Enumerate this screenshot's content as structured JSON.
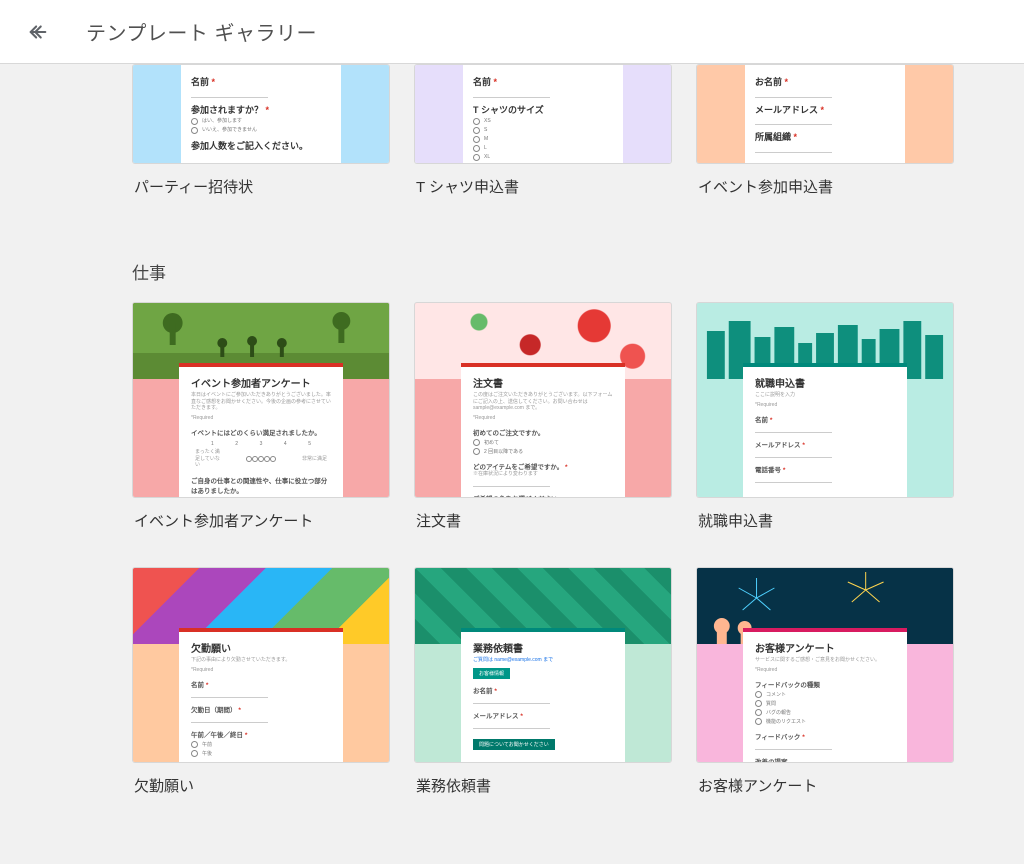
{
  "header": {
    "title": "テンプレート ギャラリー",
    "back_icon": "arrow-left"
  },
  "sections": [
    {
      "title": "",
      "cards": [
        {
          "id": "party-invite",
          "title": "パーティー招待状",
          "sideColor": "#b2e2fb",
          "fields": [
            {
              "type": "label",
              "text": "名前",
              "req": true
            },
            {
              "type": "answer"
            },
            {
              "type": "label",
              "text": "参加されますか？",
              "req": true
            },
            {
              "type": "radio",
              "text": "はい、参加します"
            },
            {
              "type": "radio",
              "text": "いいえ、参加できません"
            },
            {
              "type": "label",
              "text": "参加人数をご記入ください。"
            }
          ]
        },
        {
          "id": "tshirt-signup",
          "title": "T シャツ申込書",
          "sideColor": "#e6defb",
          "fields": [
            {
              "type": "label",
              "text": "名前",
              "req": true
            },
            {
              "type": "answer"
            },
            {
              "type": "label",
              "text": "T シャツのサイズ"
            },
            {
              "type": "radio",
              "text": "XS"
            },
            {
              "type": "radio",
              "text": "S"
            },
            {
              "type": "radio",
              "text": "M"
            },
            {
              "type": "radio",
              "text": "L"
            },
            {
              "type": "radio",
              "text": "XL"
            }
          ]
        },
        {
          "id": "event-registration",
          "title": "イベント参加申込書",
          "sideColor": "#ffc9a8",
          "fields": [
            {
              "type": "label",
              "text": "お名前",
              "req": true
            },
            {
              "type": "answer"
            },
            {
              "type": "label",
              "text": "メールアドレス",
              "req": true
            },
            {
              "type": "answer"
            },
            {
              "type": "label",
              "text": "所属組織",
              "req": true
            },
            {
              "type": "answer"
            }
          ]
        }
      ]
    },
    {
      "title": "仕事",
      "cards": [
        {
          "id": "event-feedback",
          "title": "イベント参加者アンケート",
          "accent": "#d93025",
          "bannerClass": "photo-park",
          "sideColor": "#f7a8a8",
          "form": {
            "heading": "イベント参加者アンケート",
            "desc": "本日はイベントにご参加いただきありがとうございました。率直なご感想をお聞かせください。今後の企画の参考にさせていただきます。",
            "required": "*Required",
            "q1": "イベントにはどのくらい満足されましたか。",
            "scale": [
              "1",
              "2",
              "3",
              "4",
              "5"
            ],
            "scaleLabels": [
              "まったく満足していない",
              "非常に満足"
            ],
            "q2": "ご自身の仕事との関連性や、仕事に役立つ部分はありましたか。"
          }
        },
        {
          "id": "order-form",
          "title": "注文書",
          "accent": "#d93025",
          "bannerClass": "flower-bg",
          "sideColor": "#f7a8a8",
          "form": {
            "heading": "注文書",
            "desc": "この度はご注文いただきありがとうございます。以下フォームにご記入の上、送信してください。お問い合わせは sample@example.com まで。",
            "required": "*Required",
            "q1": "初めてのご注文ですか。",
            "opts": [
              "初めて",
              "2 回目以降である"
            ],
            "q2": "どのアイテムをご希望ですか。",
            "sub": "※在庫状況により変わります",
            "q3": "ご希望の色をお選びください"
          }
        },
        {
          "id": "job-application",
          "title": "就職申込書",
          "accent": "#00897b",
          "bannerClass": "sky",
          "sideColor": "#b9ece3",
          "form": {
            "heading": "就職申込書",
            "desc": "ここに説明を入力",
            "required": "*Required",
            "fields": [
              {
                "label": "名前",
                "req": true
              },
              {
                "label": "メールアドレス",
                "req": true
              },
              {
                "label": "電話番号",
                "req": true
              }
            ]
          }
        },
        {
          "id": "absence-request",
          "title": "欠勤願い",
          "accent": "#d93025",
          "bannerClass": "rainbow",
          "sideColor": "#ffc9a0",
          "form": {
            "heading": "欠勤願い",
            "desc": "下記の事由により欠勤させていただきます。",
            "required": "*Required",
            "fields": [
              {
                "label": "名前",
                "req": true
              },
              {
                "label": "欠勤日（期間）",
                "req": true
              },
              {
                "label": "午前／午後／終日",
                "req": true,
                "opts": [
                  "午前",
                  "午後"
                ]
              }
            ]
          }
        },
        {
          "id": "work-request",
          "title": "業務依頼書",
          "accent": "#00897b",
          "bannerClass": "greenmap",
          "sideColor": "#bfe8d6",
          "form": {
            "heading": "業務依頼書",
            "desc": "ご質問は name@example.com まで",
            "btn1": "お客様情報",
            "fields": [
              {
                "label": "お名前",
                "req": true
              },
              {
                "label": "メールアドレス",
                "req": true
              }
            ],
            "btn2": "問題についてお聞かせください"
          }
        },
        {
          "id": "customer-feedback",
          "title": "お客様アンケート",
          "accent": "#d81b60",
          "bannerClass": "fireworks",
          "sideColor": "#f9b6dc",
          "form": {
            "heading": "お客様アンケート",
            "desc": "サービスに関するご感想・ご意見をお聞かせください。",
            "required": "*Required",
            "group": "フィードバックの種類",
            "opts": [
              "コメント",
              "質問",
              "バグの報告",
              "機能のリクエスト"
            ],
            "group2": "フィードバック",
            "req": true,
            "group3": "改善の提案"
          }
        }
      ]
    }
  ]
}
